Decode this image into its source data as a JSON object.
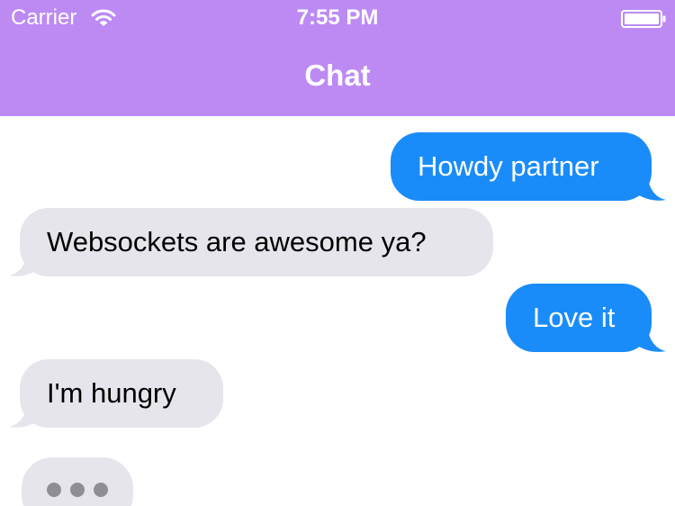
{
  "status_bar": {
    "carrier": "Carrier",
    "time": "7:55 PM",
    "wifi_icon": "wifi-icon",
    "battery_icon": "battery-icon"
  },
  "nav": {
    "title": "Chat"
  },
  "messages": [
    {
      "text": "Howdy partner",
      "direction": "outgoing"
    },
    {
      "text": "Websockets are awesome ya?",
      "direction": "incoming"
    },
    {
      "text": "Love it",
      "direction": "outgoing"
    },
    {
      "text": "I'm hungry",
      "direction": "incoming"
    }
  ],
  "typing_indicator": {
    "visible": true,
    "icon": "typing-dots-icon"
  },
  "colors": {
    "header_bg": "#bd8af4",
    "outgoing_bubble": "#1a8cf9",
    "incoming_bubble": "#e6e5eb",
    "typing_dot": "#8f8e94"
  }
}
